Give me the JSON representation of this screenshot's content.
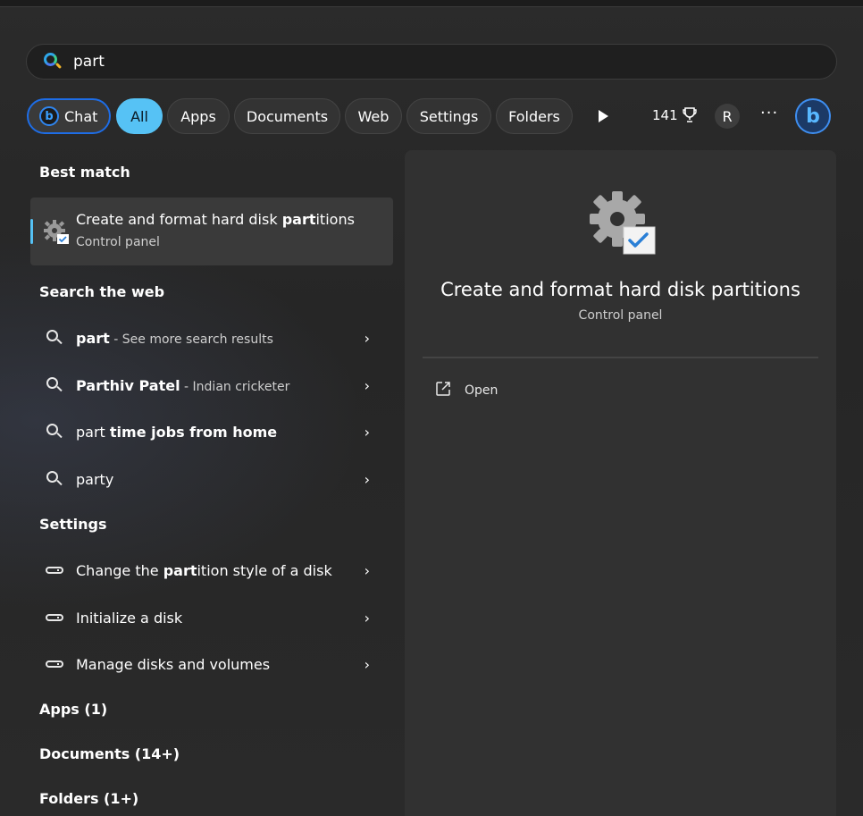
{
  "search": {
    "query": "part"
  },
  "filters": {
    "chat": "Chat",
    "all": "All",
    "apps": "Apps",
    "documents": "Documents",
    "web": "Web",
    "settings": "Settings",
    "folders": "Folders",
    "points": "141",
    "avatar_initial": "R",
    "more": "···"
  },
  "best_match": {
    "heading": "Best match",
    "title_pre": "Create and format hard disk ",
    "title_bold": "part",
    "title_post": "itions",
    "subtitle": "Control panel"
  },
  "web": {
    "heading": "Search the web",
    "items": [
      {
        "bold": "part",
        "normal": "",
        "muted": " - See more search results"
      },
      {
        "bold": "Parthiv Patel",
        "normal": "",
        "muted": " - Indian cricketer"
      },
      {
        "bold": "",
        "normal": "part ",
        "bold2": "time jobs from home"
      },
      {
        "bold": "",
        "normal": "party"
      }
    ]
  },
  "settings": {
    "heading": "Settings",
    "items": [
      {
        "pre": "Change the ",
        "bold": "part",
        "post": "ition style of a disk"
      },
      {
        "pre": "Initialize a disk",
        "bold": "",
        "post": ""
      },
      {
        "pre": "Manage disks and volumes",
        "bold": "",
        "post": ""
      }
    ]
  },
  "categories": {
    "apps": "Apps (1)",
    "documents": "Documents (14+)",
    "folders": "Folders (1+)"
  },
  "preview": {
    "title": "Create and format hard disk partitions",
    "subtitle": "Control panel",
    "open_label": "Open"
  },
  "colors": {
    "accent": "#56c2f5",
    "chat_border": "#1e6de6",
    "background": "#2b2b2b",
    "pane": "#313131"
  }
}
